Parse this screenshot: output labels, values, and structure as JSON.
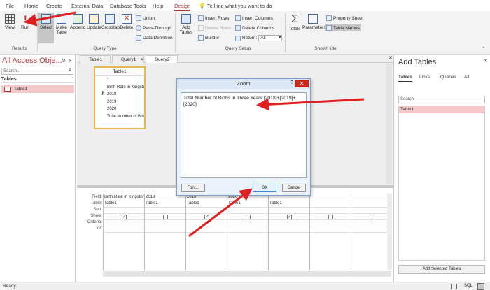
{
  "ribbon_tabs": [
    "File",
    "Home",
    "Create",
    "External Data",
    "Database Tools",
    "Help",
    "Design"
  ],
  "tell_me": "Tell me what you want to do",
  "ribbon": {
    "results": {
      "view": "View",
      "run": "Run",
      "label": "Results"
    },
    "query_type": {
      "select": "Select",
      "make_table": "Make Table",
      "append": "Append",
      "update": "Update",
      "crosstab": "Crosstab",
      "delete": "Delete",
      "union": "Union",
      "pass_through": "Pass-Through",
      "data_definition": "Data Definition",
      "label": "Query Type"
    },
    "query_setup": {
      "show_table": "Add Tables",
      "insert_rows": "Insert Rows",
      "delete_rows": "Delete Rows",
      "builder": "Builder",
      "insert_columns": "Insert Columns",
      "delete_columns": "Delete Columns",
      "return_label": "Return:",
      "return_value": "All",
      "label": "Query Setup"
    },
    "show_hide": {
      "totals": "Totals",
      "parameters": "Parameters",
      "property_sheet": "Property Sheet",
      "table_names": "Table Names",
      "label": "Show/Hide"
    }
  },
  "nav": {
    "title": "All Access Obje...",
    "search_placeholder": "Search...",
    "tables_header": "Tables",
    "items": [
      "Table1"
    ]
  },
  "doc_tabs": [
    "Table1",
    "Query1",
    "Query2"
  ],
  "field_list": {
    "title": "Table1",
    "fields": [
      "*",
      "Birth Rate in Kingston",
      "2018",
      "2019",
      "2020",
      "Total Number of Birth"
    ]
  },
  "grid": {
    "row_labels": [
      "Field:",
      "Table:",
      "Sort:",
      "Show:",
      "Criteria:",
      "or:"
    ],
    "columns": [
      {
        "field": "Birth Rate in Kingston",
        "table": "Table1",
        "show": true
      },
      {
        "field": "2018",
        "table": "Table1",
        "show": false
      },
      {
        "field": "2019",
        "table": "Table1",
        "show": true
      },
      {
        "field": "2020",
        "table": "Table1",
        "show": false
      },
      {
        "field": "",
        "table": "Table1",
        "show": true
      },
      {
        "field": "",
        "table": "",
        "show": false
      },
      {
        "field": "",
        "table": "",
        "show": false
      }
    ]
  },
  "add_tables": {
    "title": "Add Tables",
    "tabs": [
      "Tables",
      "Links",
      "Queries",
      "All"
    ],
    "search_placeholder": "Search",
    "items": [
      "Table1"
    ],
    "button": "Add Selected Tables"
  },
  "zoom": {
    "title": "Zoom",
    "help": "?",
    "close": "✕",
    "text": "Total Number of Births in Three Years:[2018]+[2019]+[2020]",
    "font_button": "Font...",
    "ok_button": "OK",
    "cancel_button": "Cancel"
  },
  "status": {
    "text": "Ready",
    "sql": "SQL"
  },
  "colors": {
    "accent": "#a4373a",
    "arrow": "#e02020"
  }
}
